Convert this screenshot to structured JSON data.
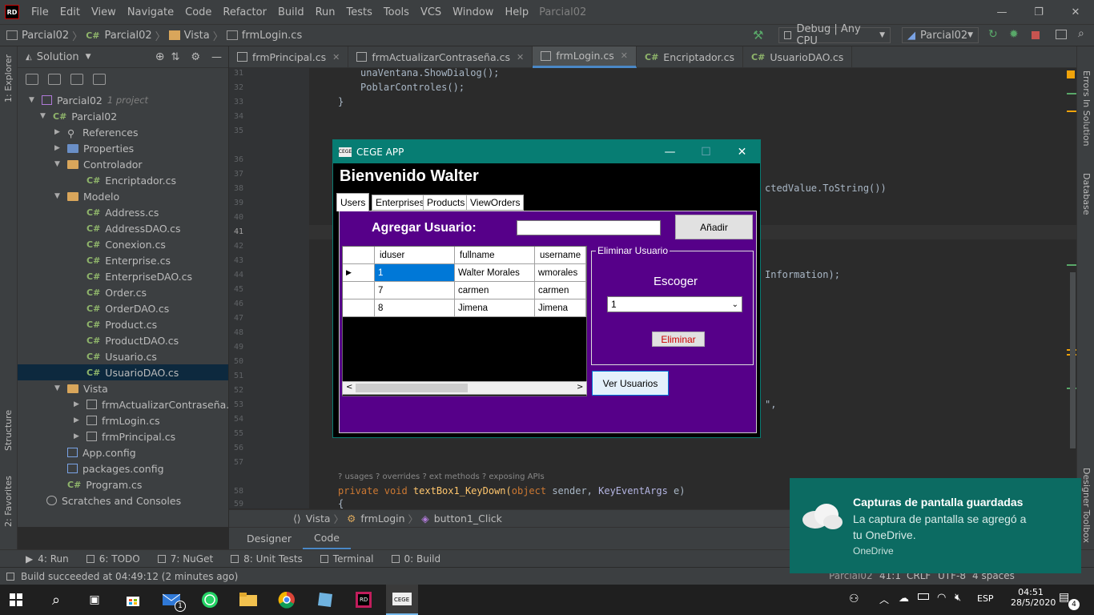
{
  "menubar": {
    "logo": "RD",
    "items": [
      "File",
      "Edit",
      "View",
      "Navigate",
      "Code",
      "Refactor",
      "Build",
      "Run",
      "Tests",
      "Tools",
      "VCS",
      "Window",
      "Help"
    ],
    "project": "Parcial02"
  },
  "navbar": {
    "crumbs": [
      "Parcial02",
      "Parcial02",
      "Vista",
      "frmLogin.cs"
    ],
    "config": "Debug | Any CPU",
    "run_target": "Parcial02"
  },
  "sidebar_left": {
    "explorer": "1: Explorer",
    "structure": "Structure",
    "favorites": "2: Favorites"
  },
  "sidebar_right": {
    "errors": "Errors In Solution",
    "database": "Database",
    "designer": "Designer Toolbox"
  },
  "solution": {
    "title": "Solution",
    "tree": [
      {
        "label": "Parcial02",
        "note": "1 project",
        "depth": 0,
        "kind": "solution"
      },
      {
        "label": "Parcial02",
        "depth": 1,
        "kind": "cs"
      },
      {
        "label": "References",
        "depth": 2,
        "kind": "ref"
      },
      {
        "label": "Properties",
        "depth": 2,
        "kind": "prop"
      },
      {
        "label": "Controlador",
        "depth": 2,
        "kind": "folder"
      },
      {
        "label": "Encriptador.cs",
        "depth": 3,
        "kind": "cs"
      },
      {
        "label": "Modelo",
        "depth": 2,
        "kind": "folder"
      },
      {
        "label": "Address.cs",
        "depth": 3,
        "kind": "cs"
      },
      {
        "label": "AddressDAO.cs",
        "depth": 3,
        "kind": "cs"
      },
      {
        "label": "Conexion.cs",
        "depth": 3,
        "kind": "cs"
      },
      {
        "label": "Enterprise.cs",
        "depth": 3,
        "kind": "cs"
      },
      {
        "label": "EnterpriseDAO.cs",
        "depth": 3,
        "kind": "cs"
      },
      {
        "label": "Order.cs",
        "depth": 3,
        "kind": "cs"
      },
      {
        "label": "OrderDAO.cs",
        "depth": 3,
        "kind": "cs"
      },
      {
        "label": "Product.cs",
        "depth": 3,
        "kind": "cs"
      },
      {
        "label": "ProductDAO.cs",
        "depth": 3,
        "kind": "cs"
      },
      {
        "label": "Usuario.cs",
        "depth": 3,
        "kind": "cs"
      },
      {
        "label": "UsuarioDAO.cs",
        "depth": 3,
        "kind": "cs",
        "selected": true
      },
      {
        "label": "Vista",
        "depth": 2,
        "kind": "folder"
      },
      {
        "label": "frmActualizarContraseña.cs",
        "depth": 3,
        "kind": "form"
      },
      {
        "label": "frmLogin.cs",
        "depth": 3,
        "kind": "form"
      },
      {
        "label": "frmPrincipal.cs",
        "depth": 3,
        "kind": "form"
      },
      {
        "label": "App.config",
        "depth": 2,
        "kind": "file"
      },
      {
        "label": "packages.config",
        "depth": 2,
        "kind": "file"
      },
      {
        "label": "Program.cs",
        "depth": 2,
        "kind": "cs"
      },
      {
        "label": "Scratches and Consoles",
        "depth": 0,
        "kind": "scratch"
      }
    ]
  },
  "tabs": [
    {
      "label": "frmPrincipal.cs",
      "active": false
    },
    {
      "label": "frmActualizarContraseña.cs",
      "active": false
    },
    {
      "label": "frmLogin.cs",
      "active": true
    },
    {
      "label": "Encriptador.cs",
      "active": false
    },
    {
      "label": "UsuarioDAO.cs",
      "active": false
    }
  ],
  "editor": {
    "line_numbers": [
      "31",
      "32",
      "33",
      "34",
      "35",
      "36",
      "37",
      "38",
      "39",
      "40",
      "41",
      "42",
      "43",
      "44",
      "45",
      "46",
      "47",
      "48",
      "49",
      "50",
      "51",
      "52",
      "53",
      "54",
      "55",
      "56",
      "57",
      "58",
      "59"
    ],
    "code_lines": [
      {
        "n": "31",
        "text": "unaVentana.ShowDialog();"
      },
      {
        "n": "32",
        "text": "PoblarControles();"
      },
      {
        "n": "33",
        "text": "}"
      },
      {
        "n": "38",
        "text": "ctedValue.ToString())"
      },
      {
        "n": "44",
        "text": "Information);"
      },
      {
        "n": "53",
        "text": "\","
      },
      {
        "n": "55",
        "text": "}"
      },
      {
        "n": "58",
        "text": "private void textBox1_KeyDown(object sender, KeyEventArgs e)"
      },
      {
        "n": "59",
        "text": "{"
      }
    ],
    "hints": "? usages   ? overrides   ? ext methods   ? exposing APIs",
    "breadcrumb": [
      "Vista",
      "frmLogin",
      "button1_Click"
    ],
    "design_tabs": [
      "Designer",
      "Code"
    ]
  },
  "toolwindows": [
    "4: Run",
    "6: TODO",
    "7: NuGet",
    "8: Unit Tests",
    "Terminal",
    "0: Build"
  ],
  "status": {
    "message": "Build succeeded at 04:49:12 (2 minutes ago)",
    "project": "Parcial02",
    "position": "41:1",
    "line_ending": "CRLF",
    "encoding": "UTF-8",
    "indent": "4 spaces"
  },
  "winform": {
    "title": "CEGE APP",
    "welcome": "Bienvenido Walter",
    "tabs": [
      "Users",
      "Enterprises",
      "Products",
      "ViewOrders"
    ],
    "add_label": "Agregar Usuario:",
    "add_button": "Añadir",
    "grid_headers": [
      "iduser",
      "fullname",
      "username"
    ],
    "grid_rows": [
      [
        "1",
        "Walter Morales",
        "wmorales"
      ],
      [
        "7",
        "carmen",
        "carmen"
      ],
      [
        "8",
        "Jimena",
        "Jimena"
      ]
    ],
    "group_title": "Eliminar Usuario",
    "choose_label": "Escoger",
    "combo_value": "1",
    "delete_button": "Eliminar",
    "view_button": "Ver Usuarios"
  },
  "toast": {
    "title": "Capturas de pantalla guardadas",
    "body": "La captura de pantalla se agregó a tu OneDrive.",
    "source": "OneDrive"
  },
  "taskbar": {
    "lang": "ESP",
    "time": "04:51",
    "date": "28/5/2020",
    "mail_badge": "1",
    "notif_badge": "4"
  },
  "colors": {
    "accent": "#4a88c7",
    "form_title": "#077d73",
    "tab_page": "#560089",
    "toast": "#0c6b62"
  }
}
